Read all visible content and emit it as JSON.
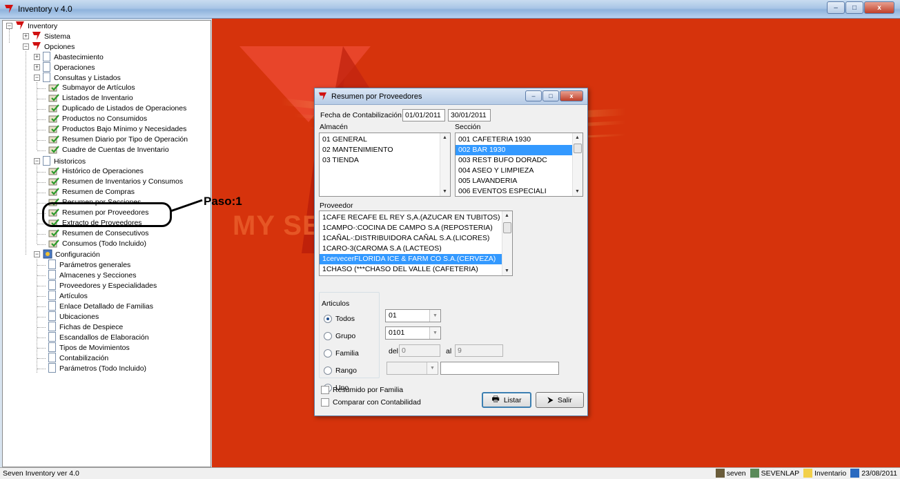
{
  "window": {
    "title": "Inventory v 4.0",
    "minimize": "–",
    "maximize": "□",
    "close": "x"
  },
  "tree": {
    "root": "Inventory",
    "sistema": "Sistema",
    "opciones": "Opciones",
    "abastecimiento": "Abastecimiento",
    "operaciones": "Operaciones",
    "consultas": "Consultas y Listados",
    "consultas_items": [
      "Submayor de Artículos",
      "Listados de Inventario",
      "Duplicado de Listados de Operaciones",
      "Productos no Consumidos",
      "Productos Bajo Mínimo y Necesidades",
      "Resumen Diario por Tipo de Operación",
      "Cuadre de Cuentas de Inventario"
    ],
    "historicos": "Historicos",
    "historicos_items": [
      "Histórico de Operaciones",
      "Resumen de Inventarios y Consumos",
      "Resumen de Compras",
      "Resumen por Secciones",
      "Resumen por Proveedores",
      "Extracto de Proveedores",
      "Resumen de Consecutivos",
      "Consumos (Todo Incluido)"
    ],
    "configuracion": "Configuración",
    "config_items": [
      "Parámetros generales",
      "Almacenes y Secciones",
      "Proveedores y Especialidades",
      "Artículos",
      "Enlace Detallado de Familias",
      "Ubicaciones",
      "Fichas de Despiece",
      "Escandallos de Elaboración",
      "Tipos de Movimientos",
      "Contabilización",
      "Parámetros (Todo Incluido)"
    ]
  },
  "callout": {
    "label": "Paso:1"
  },
  "background": {
    "brand": "MY SEVE"
  },
  "dialog": {
    "title": "Resumen por Proveedores",
    "fecha_label": "Fecha de Contabilización",
    "fecha_desde": "01/01/2011",
    "fecha_hasta": "30/01/2011",
    "almacen_label": "Almacén",
    "almacenes": [
      "01  GENERAL",
      "02  MANTENIMIENTO",
      "03  TIENDA"
    ],
    "seccion_label": "Sección",
    "secciones": [
      "001   CAFETERIA 1930",
      "002   BAR 1930",
      "003   REST BUFO DORADC",
      "004   ASEO Y LIMPIEZA",
      "005   LAVANDERIA",
      "006   EVENTOS ESPECIALI"
    ],
    "seccion_selected": 1,
    "proveedor_label": "Proveedor",
    "proveedores": [
      "1CAFE RECAFE EL REY S,A.(AZUCAR EN TUBITOS)",
      "1CAMPO-:COCINA DE CAMPO S.A (REPOSTERIA)",
      "1CAÑAL-:DISTRIBUIDORA CAÑAL S.A.(LICORES)",
      "1CARO-3(CAROMA S.A (LACTEOS)",
      "1cervecerFLORIDA ICE & FARM CO S.A.(CERVEZA)",
      "1CHASO (***CHASO DEL VALLE (CAFETERIA)"
    ],
    "proveedor_selected": 4,
    "articulos_label": "Articulos",
    "radio_todos": "Todos",
    "radio_grupo": "Grupo",
    "radio_familia": "Familia",
    "radio_rango": "Rango",
    "radio_uno": "Uno",
    "grupo_value": "01",
    "familia_value": "0101",
    "del_label": "del",
    "del_value": "0",
    "al_label": "al",
    "al_value": "9",
    "uno_value": "",
    "uno_text": "",
    "chk_resumido": "Resumido por Familia",
    "chk_comparar": "Comparar con Contabilidad",
    "btn_listar": "Listar",
    "btn_salir": "Salir"
  },
  "statusbar": {
    "left": "Seven Inventory ver 4.0",
    "user": "seven",
    "machine": "SEVENLAP",
    "db": "Inventario",
    "date": "23/08/2011"
  }
}
